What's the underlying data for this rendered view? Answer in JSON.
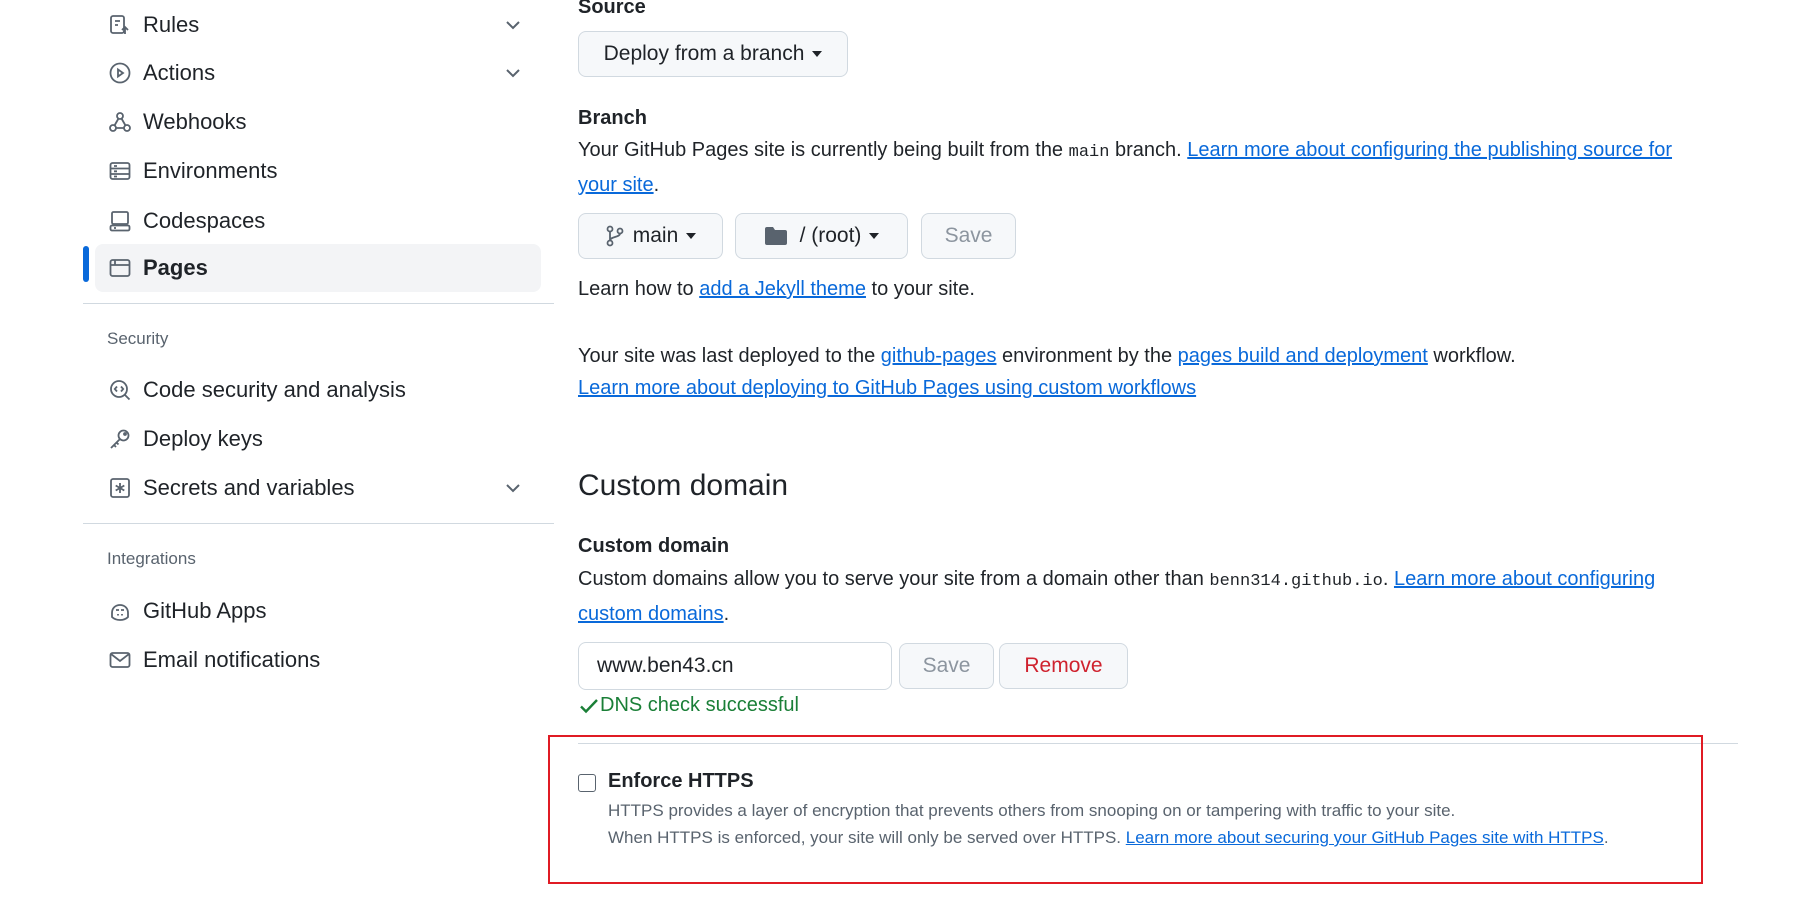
{
  "sidebar": {
    "items_top": [
      {
        "label": "Rules",
        "icon": "rules-icon",
        "expandable": true
      },
      {
        "label": "Actions",
        "icon": "actions-play-icon",
        "expandable": true
      },
      {
        "label": "Webhooks",
        "icon": "webhook-icon",
        "expandable": false
      },
      {
        "label": "Environments",
        "icon": "server-icon",
        "expandable": false
      },
      {
        "label": "Codespaces",
        "icon": "codespaces-icon",
        "expandable": false
      },
      {
        "label": "Pages",
        "icon": "browser-icon",
        "expandable": false,
        "selected": true
      }
    ],
    "security_label": "Security",
    "security_items": [
      {
        "label": "Code security and analysis",
        "icon": "codescan-icon"
      },
      {
        "label": "Deploy keys",
        "icon": "key-icon"
      },
      {
        "label": "Secrets and variables",
        "icon": "key-asterisk-icon",
        "expandable": true
      }
    ],
    "integrations_label": "Integrations",
    "integrations_items": [
      {
        "label": "GitHub Apps",
        "icon": "copilot-apps-icon"
      },
      {
        "label": "Email notifications",
        "icon": "mail-icon"
      }
    ]
  },
  "source": {
    "label": "Source",
    "dropdown": "Deploy from a branch"
  },
  "branch": {
    "label": "Branch",
    "desc_before": "Your GitHub Pages site is currently being built from the ",
    "desc_code": "main",
    "desc_after": " branch. ",
    "link": "Learn more about configuring the publishing source for your site",
    "link_line1": "Learn more about configuring the publishing source for",
    "link_line2": "your site",
    "period": ".",
    "branch_button": "main",
    "folder_button": "/ (root)",
    "save_button": "Save"
  },
  "jekyll": {
    "before": "Learn how to ",
    "link": "add a Jekyll theme",
    "after": " to your site."
  },
  "deploy": {
    "before": "Your site was last deployed to the ",
    "env_link": "github-pages",
    "middle": " environment by the ",
    "workflow_link": "pages build and deployment",
    "after": " workflow.",
    "learn_link": "Learn more about deploying to GitHub Pages using custom workflows"
  },
  "custom_domain": {
    "section_title": "Custom domain",
    "label": "Custom domain",
    "desc_before": "Custom domains allow you to serve your site from a domain other than ",
    "desc_code": "benn314.github.io",
    "desc_after": ". ",
    "link_line1": "Learn more about configuring",
    "link_line2": "custom domains",
    "period": ".",
    "input_value": "www.ben43.cn",
    "save_button": "Save",
    "remove_button": "Remove",
    "dns_status": "DNS check successful"
  },
  "https": {
    "label": "Enforce HTTPS",
    "checked": false,
    "line1": "HTTPS provides a layer of encryption that prevents others from snooping on or tampering with traffic to your site.",
    "line2_before": "When HTTPS is enforced, your site will only be served over HTTPS. ",
    "line2_link": "Learn more about securing your GitHub Pages site with HTTPS",
    "line2_after": "."
  },
  "colors": {
    "accent": "#0969da",
    "success": "#1a7f37",
    "danger": "#cf222e",
    "highlight_box": "#e01b24"
  }
}
